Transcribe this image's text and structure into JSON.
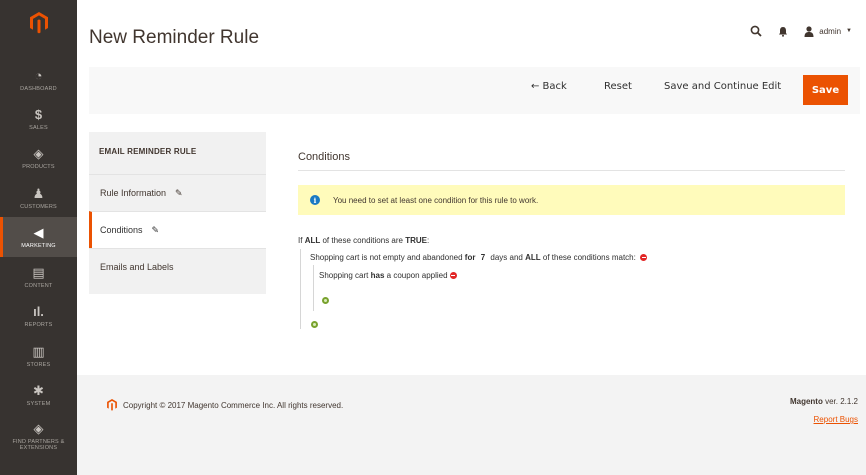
{
  "sidebar": {
    "items": [
      {
        "label": "DASHBOARD",
        "icon": "dashboard-icon",
        "glyph": "◔"
      },
      {
        "label": "SALES",
        "icon": "dollar-icon",
        "glyph": "$"
      },
      {
        "label": "PRODUCTS",
        "icon": "cube-icon",
        "glyph": "◈"
      },
      {
        "label": "CUSTOMERS",
        "icon": "person-icon",
        "glyph": "♟"
      },
      {
        "label": "MARKETING",
        "icon": "megaphone-icon",
        "glyph": "◀"
      },
      {
        "label": "CONTENT",
        "icon": "content-icon",
        "glyph": "▤"
      },
      {
        "label": "REPORTS",
        "icon": "bar-chart-icon",
        "glyph": "ıl."
      },
      {
        "label": "STORES",
        "icon": "store-icon",
        "glyph": "▥"
      },
      {
        "label": "SYSTEM",
        "icon": "gear-icon",
        "glyph": "✱"
      },
      {
        "label": "FIND PARTNERS & EXTENSIONS",
        "icon": "cube-icon",
        "glyph": "◈"
      }
    ],
    "active_index": 4
  },
  "header": {
    "title": "New Reminder Rule",
    "user": "admin"
  },
  "toolbar": {
    "back_label": "← Back",
    "reset_label": "Reset",
    "save_continue_label": "Save and Continue Edit",
    "save_label": "Save",
    "accent_color": "#eb5202"
  },
  "tabs": {
    "title": "EMAIL REMINDER RULE",
    "items": [
      {
        "label": "Rule Information",
        "editable": true
      },
      {
        "label": "Conditions",
        "editable": true,
        "active": true
      },
      {
        "label": "Emails and Labels",
        "editable": false
      }
    ]
  },
  "conditions": {
    "title": "Conditions",
    "notice": "You need to set at least one condition for this rule to work.",
    "root": {
      "prefix": "If",
      "aggregator": "ALL",
      "middle": "of these conditions are",
      "value": "TRUE",
      "suffix": ":"
    },
    "child": {
      "text1": "Shopping cart is not empty and abandoned",
      "for_word": "for",
      "days": "7",
      "text2": "days and",
      "aggregator": "ALL",
      "text3": "of these conditions match:"
    },
    "grandchild": {
      "text1": "Shopping cart",
      "operator": "has",
      "text2": "a coupon applied"
    }
  },
  "footer": {
    "copyright": "Copyright © 2017 Magento Commerce Inc. All rights reserved.",
    "brand": "Magento",
    "version": "ver. 2.1.2",
    "report_bugs": "Report Bugs"
  }
}
